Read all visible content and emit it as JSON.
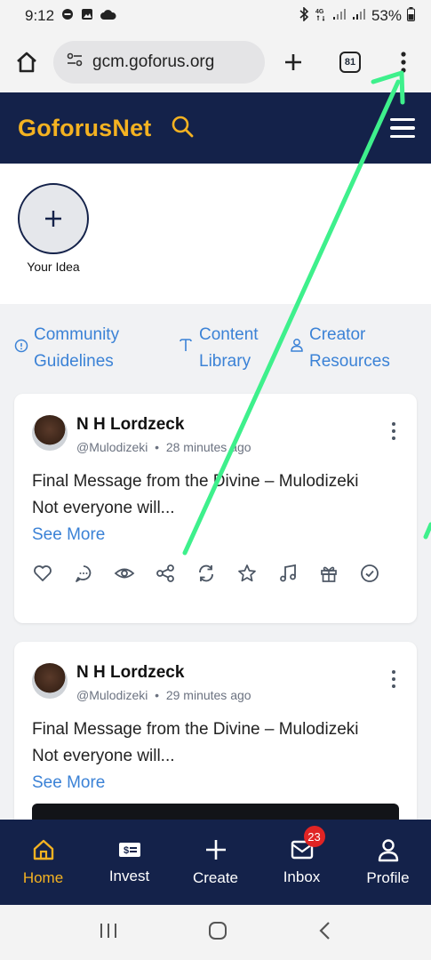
{
  "status_bar": {
    "time": "9:12",
    "battery": "53%"
  },
  "browser": {
    "url": "gcm.goforus.org",
    "tab_count": "81"
  },
  "site": {
    "brand": "GoforusNet"
  },
  "stories": {
    "add_label": "Your Idea"
  },
  "quick_links": [
    {
      "line1": "Community",
      "line2": "Guidelines"
    },
    {
      "line1": "Content",
      "line2": "Library"
    },
    {
      "line1": "Creator",
      "line2": "Resources"
    }
  ],
  "posts": [
    {
      "author": "N H Lordzeck",
      "handle": "@Mulodizeki",
      "time": "28 minutes ago",
      "line1": "Final Message from the Divine – Mulodizeki",
      "line2": "Not everyone will...",
      "see_more": "See More"
    },
    {
      "author": "N H Lordzeck",
      "handle": "@Mulodizeki",
      "time": "29 minutes ago",
      "line1": "Final Message from the Divine – Mulodizeki",
      "line2": "Not everyone will...",
      "see_more": "See More"
    }
  ],
  "bottom_nav": {
    "home": "Home",
    "invest": "Invest",
    "create": "Create",
    "inbox": "Inbox",
    "inbox_badge": "23",
    "profile": "Profile"
  },
  "colors": {
    "navy": "#14224a",
    "brand_gold": "#f4b221",
    "link_blue": "#3b82d6",
    "arrow_green": "#3ef08c"
  }
}
